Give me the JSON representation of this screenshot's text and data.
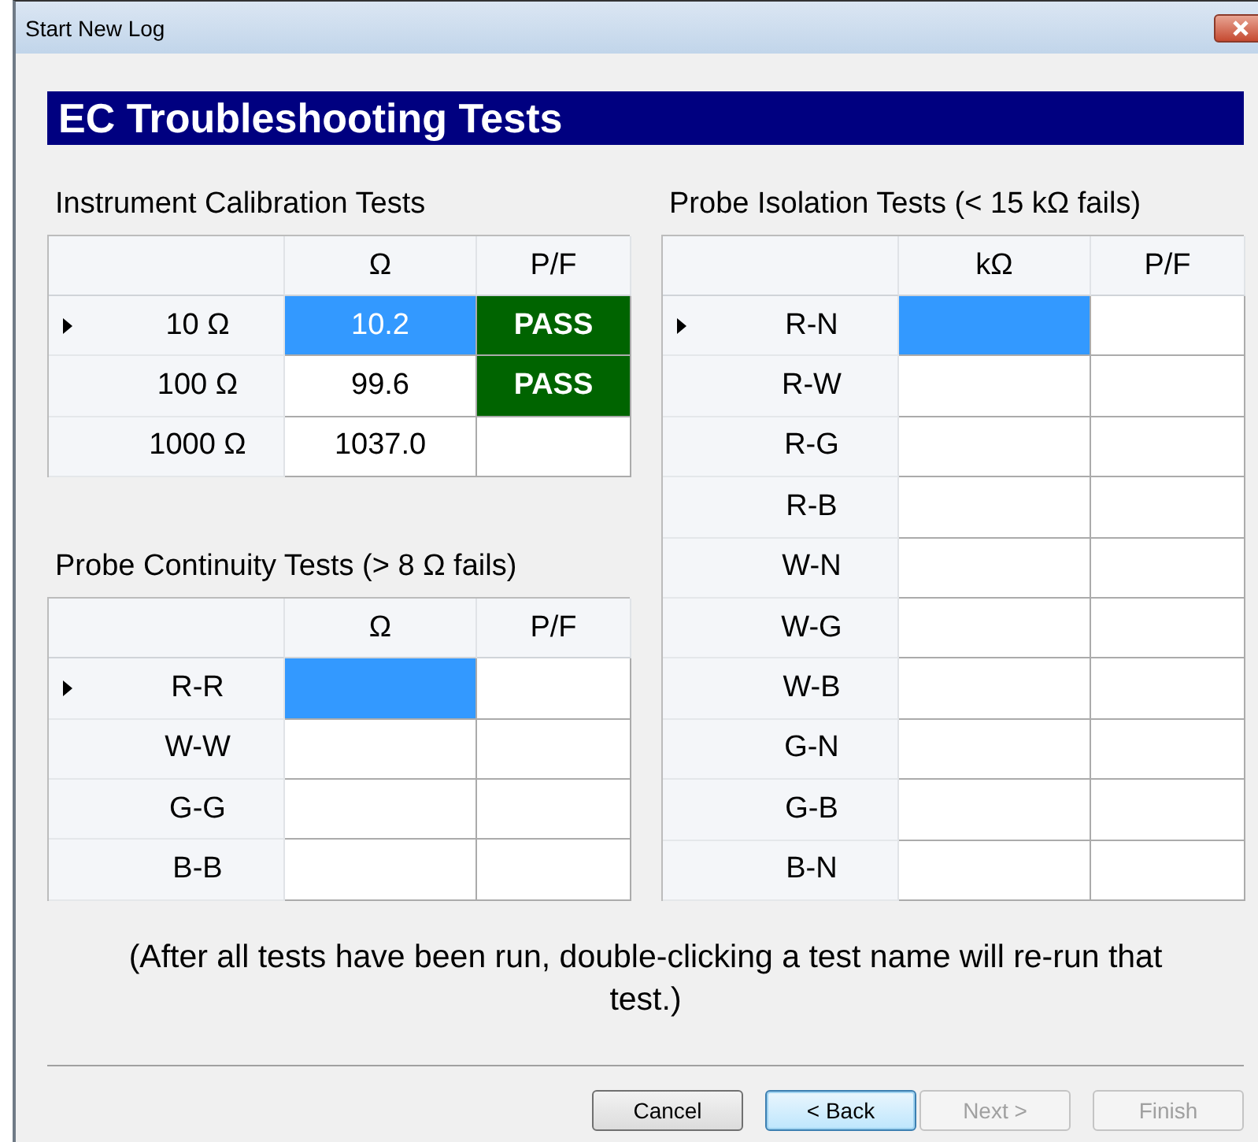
{
  "window": {
    "title": "Start New Log"
  },
  "header": "EC Troubleshooting Tests",
  "tables": [
    {
      "title": "Instrument Calibration Tests",
      "columns": [
        "Ω",
        "P/F"
      ],
      "rows": [
        {
          "label": "10 Ω",
          "current": true,
          "cells": [
            {
              "text": "10.2",
              "selected": true
            },
            {
              "text": "PASS",
              "selected": false,
              "kind": "pass"
            }
          ]
        },
        {
          "label": "100 Ω",
          "current": false,
          "cells": [
            {
              "text": "99.6",
              "selected": false
            },
            {
              "text": "PASS",
              "selected": false,
              "kind": "pass"
            }
          ]
        },
        {
          "label": "1000 Ω",
          "current": false,
          "cells": [
            {
              "text": "1037.0",
              "selected": false
            },
            {
              "selected": false
            }
          ]
        }
      ]
    },
    {
      "title": "Probe Continuity Tests (> 8 Ω fails)",
      "columns": [
        "Ω",
        "P/F"
      ],
      "rows": [
        {
          "label": "R-R",
          "current": true,
          "cells": [
            {
              "selected": true
            },
            {
              "selected": false
            }
          ]
        },
        {
          "label": "W-W",
          "current": false,
          "cells": [
            {
              "selected": false
            },
            {
              "selected": false
            }
          ]
        },
        {
          "label": "G-G",
          "current": false,
          "cells": [
            {
              "selected": false
            },
            {
              "selected": false
            }
          ]
        },
        {
          "label": "B-B",
          "current": false,
          "cells": [
            {
              "selected": false
            },
            {
              "selected": false
            }
          ]
        }
      ]
    },
    {
      "title": "Probe Isolation Tests (< 15 kΩ fails)",
      "columns": [
        "kΩ",
        "P/F"
      ],
      "rows": [
        {
          "label": "R-N",
          "current": true,
          "cells": [
            {
              "selected": true
            },
            {
              "selected": false
            }
          ]
        },
        {
          "label": "R-W",
          "current": false,
          "cells": [
            {
              "selected": false
            },
            {
              "selected": false
            }
          ]
        },
        {
          "label": "R-G",
          "current": false,
          "cells": [
            {
              "selected": false
            },
            {
              "selected": false
            }
          ]
        },
        {
          "label": "R-B",
          "current": false,
          "cells": [
            {
              "selected": false
            },
            {
              "selected": false
            }
          ]
        },
        {
          "label": "W-N",
          "current": false,
          "cells": [
            {
              "selected": false
            },
            {
              "selected": false
            }
          ]
        },
        {
          "label": "W-G",
          "current": false,
          "cells": [
            {
              "selected": false
            },
            {
              "selected": false
            }
          ]
        },
        {
          "label": "W-B",
          "current": false,
          "cells": [
            {
              "selected": false
            },
            {
              "selected": false
            }
          ]
        },
        {
          "label": "G-N",
          "current": false,
          "cells": [
            {
              "selected": false
            },
            {
              "selected": false
            }
          ]
        },
        {
          "label": "G-B",
          "current": false,
          "cells": [
            {
              "selected": false
            },
            {
              "selected": false
            }
          ]
        },
        {
          "label": "B-N",
          "current": false,
          "cells": [
            {
              "selected": false
            },
            {
              "selected": false
            }
          ]
        }
      ]
    }
  ],
  "note": "(After all tests have been run, double-clicking a test name will re-run that test.)",
  "buttons": [
    {
      "label": "Cancel",
      "default": false,
      "disabled": false
    },
    {
      "label": "< Back",
      "default": true,
      "disabled": false
    },
    {
      "label": "Next >",
      "default": false,
      "disabled": true
    },
    {
      "label": "Finish",
      "default": false,
      "disabled": true
    }
  ]
}
